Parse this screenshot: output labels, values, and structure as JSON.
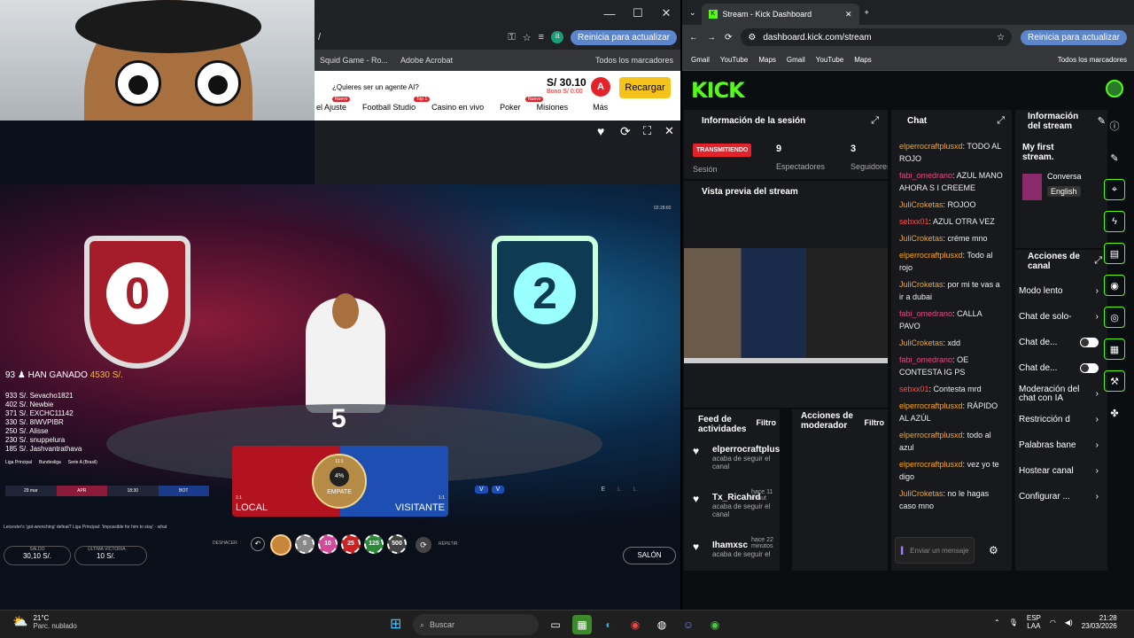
{
  "left_browser": {
    "tabs_controls": [
      "—",
      "☐",
      "✕"
    ],
    "address_fragment": "/",
    "update_button": "Reinicia para actualizar",
    "avatar_letter": "a",
    "bookmarks": [
      "Squid Game - Ro...",
      "Adobe Acrobat",
      "Todos los marcadores"
    ]
  },
  "casino": {
    "agent_prompt": "¿Quieres ser un agente AI?",
    "balance": "S/ 30.10",
    "bono": "Bono S/ 0.00",
    "avatar_letter": "A",
    "recharge": "Recargar",
    "nav": [
      "el Ajuste",
      "Football Studio",
      "Casino en vivo",
      "Poker",
      "Misiones",
      "Más"
    ],
    "badges": [
      "Nuevo",
      "Top 1",
      "Nuevo"
    ]
  },
  "game": {
    "winners_header": "93 ♟ HAN GANADO",
    "winners_total": "4530 S/.",
    "winners": [
      {
        "amount": "933 S/.",
        "name": "Sevacho1821"
      },
      {
        "amount": "402 S/.",
        "name": "Newbie"
      },
      {
        "amount": "371 S/.",
        "name": "EXCHC11142"
      },
      {
        "amount": "330 S/.",
        "name": "8IWVPIBR"
      },
      {
        "amount": "250 S/.",
        "name": "Alisse"
      },
      {
        "amount": "230 S/.",
        "name": "snuppelura"
      },
      {
        "amount": "185 S/.",
        "name": "Jashvantrathava"
      }
    ],
    "leagues": [
      "Liga Principal",
      "Bundesliga",
      "Serie A (Brasil)"
    ],
    "match_date": "29 mar",
    "match_teams": [
      "APR",
      "18:30",
      "BOT"
    ],
    "countdown": "5",
    "bet_local": "LOCAL",
    "bet_empate": "EMPATE",
    "bet_visitante": "VISITANTE",
    "empate_pct": "4%",
    "local_odds": "1:1",
    "visit_odds": "1:1",
    "empate_odds": "11:1",
    "timer": "02:28:60",
    "ticker": "Leicester's 'gut-wrenching' defeat?   Liga Principal: 'Impossible for him to stay' - what",
    "chips": [
      "5",
      "10",
      "25",
      "125",
      "500"
    ],
    "undo": "DESHACER",
    "repeat": "REPETIR",
    "saldo_label": "SALDO",
    "saldo": "30,10 S/.",
    "last_win_label": "ÚLTIMA VICTORIA",
    "last_win": "10 S/.",
    "lobby": "SALÓN",
    "shield_left": "0",
    "shield_right": "2",
    "score_v": [
      "V",
      "V",
      "E",
      "L",
      "L"
    ]
  },
  "right_browser": {
    "tab_title": "Stream - Kick Dashboard",
    "url": "dashboard.kick.com/stream",
    "update_button": "Reinicia para actualizar",
    "bookmarks": [
      "Gmail",
      "YouTube",
      "Maps",
      "Gmail",
      "YouTube",
      "Maps",
      "Todos los marcadores"
    ]
  },
  "kick": {
    "logo": "KICK",
    "session": {
      "title": "Información de la sesión",
      "status": "TRANSMITIENDO",
      "status_label": "Sesión",
      "viewers": "9",
      "viewers_label": "Espectadores",
      "followers": "3",
      "followers_label": "Seguidores"
    },
    "preview_title": "Vista previa del stream",
    "feed": {
      "title": "Feed de actividades",
      "filter": "Filtro",
      "items": [
        {
          "user": "elperrocraftplus",
          "text": "acaba de seguir el canal",
          "time": ""
        },
        {
          "user": "Tx_Ricahrd",
          "text": "acaba de seguir el canal",
          "time": "hace 11 minut"
        },
        {
          "user": "Ihamxsc",
          "text": "acaba de seguir el",
          "time": "hace 22 minutos"
        }
      ]
    },
    "mod": {
      "title": "Acciones de moderador",
      "filter": "Filtro"
    },
    "chat": {
      "title": "Chat",
      "placeholder": "Enviar un mensaje",
      "messages": [
        {
          "user": "elperrocraftplusxd",
          "color": "u-or",
          "text": "TODO AL ROJO"
        },
        {
          "user": "fabi_omedrano",
          "color": "u-pk",
          "text": "AZUL MANO AHORA S I CREEME"
        },
        {
          "user": "JuliCroketas",
          "color": "u-or",
          "text": "ROJOO"
        },
        {
          "user": "sebxx01",
          "color": "u-rd",
          "text": "AZUL OTRA VEZ"
        },
        {
          "user": "JuliCroketas",
          "color": "u-or",
          "text": "créme mno"
        },
        {
          "user": "elperrocraftplusxd",
          "color": "u-or",
          "text": "Todo al rojo"
        },
        {
          "user": "JuliCroketas",
          "color": "u-or",
          "text": "por mi te vas a ir a dubai"
        },
        {
          "user": "fabi_omedrano",
          "color": "u-pk",
          "text": "CALLA PAVO"
        },
        {
          "user": "JuliCroketas",
          "color": "u-or",
          "text": "xdd"
        },
        {
          "user": "fabi_omedrano",
          "color": "u-pk",
          "text": "OE CONTESTA IG PS"
        },
        {
          "user": "sebxx01",
          "color": "u-rd",
          "text": "Contesta mrd"
        },
        {
          "user": "elperrocraftplusxd",
          "color": "u-or",
          "text": "RÁPIDO AL AZÚL"
        },
        {
          "user": "elperrocraftplusxd",
          "color": "u-or",
          "text": "todo al azul"
        },
        {
          "user": "elperrocraftplusxd",
          "color": "u-or",
          "text": "vez yo te digo"
        },
        {
          "user": "JuliCroketas",
          "color": "u-or",
          "text": "no le hagas caso mno"
        }
      ]
    },
    "info": {
      "title": "Información del stream",
      "stream_title": "My first stream.",
      "category": "Conversa",
      "language": "English"
    },
    "actions": {
      "title": "Acciones de canal",
      "items": [
        "Modo lento",
        "Chat de solo-",
        "Chat de...",
        "Chat de...",
        "Moderación del chat con IA",
        "Restricción d",
        "Palabras bane",
        "Hostear canal",
        "Configurar ..."
      ]
    }
  },
  "taskbar": {
    "weather_temp": "21°C",
    "weather_desc": "Parc. nublado",
    "search": "Buscar",
    "lang": "ESP",
    "lang2": "LAA",
    "time": "21:28",
    "date": "23/03/2026"
  }
}
